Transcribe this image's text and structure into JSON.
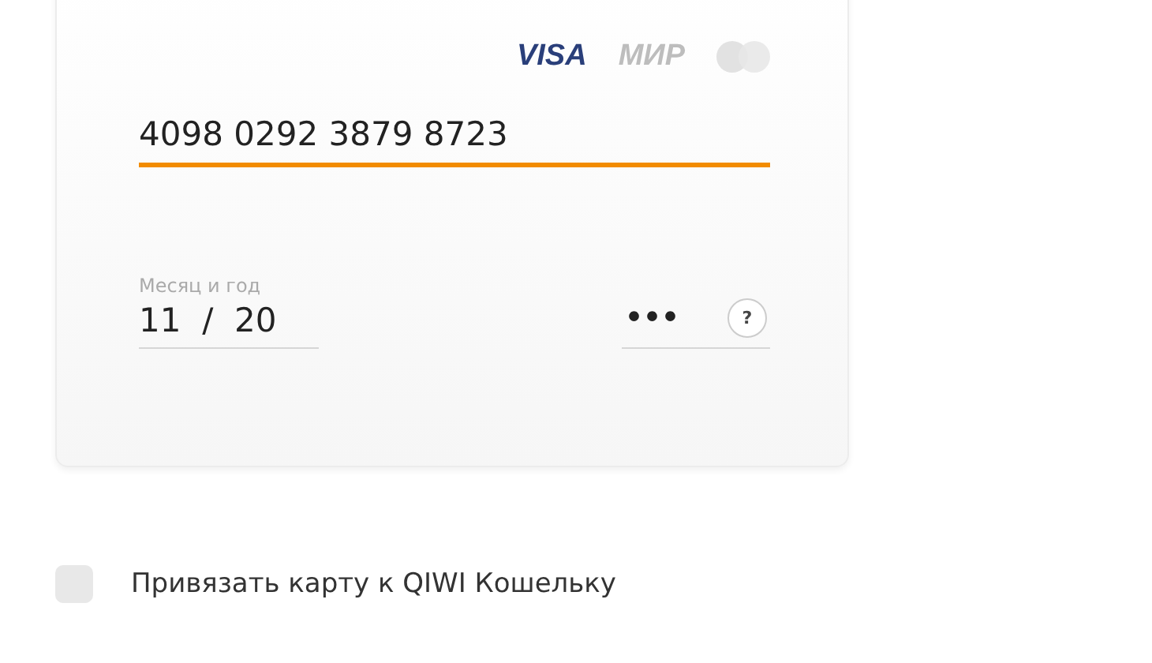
{
  "card": {
    "brands": [
      {
        "kind": "text",
        "label": "VISA",
        "active": true
      },
      {
        "kind": "text",
        "label": "МИР",
        "active": false
      },
      {
        "kind": "circles",
        "active": false
      }
    ],
    "number": {
      "value": "4098 0292 3879 8723",
      "focused": true
    },
    "expiry": {
      "label": "Месяц и год",
      "value": "11  /  20"
    },
    "cvv": {
      "value": "•••",
      "help": "?"
    }
  },
  "bind_checkbox": {
    "label": "Привязать карту к QIWI Кошельку",
    "checked": false
  }
}
